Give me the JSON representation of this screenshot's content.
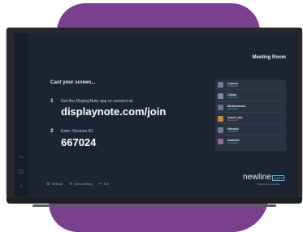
{
  "header": {
    "room_name": "Meeting Room"
  },
  "main": {
    "title": "Cast your screen...",
    "steps": [
      {
        "number": "1",
        "text": "Get the DisplayNote app or connect at:",
        "highlight": "displaynote.com/join"
      },
      {
        "number": "2",
        "text": "Enter Session ID:",
        "highlight": "667024"
      }
    ]
  },
  "sidebar": {
    "items": [
      {
        "icon": "display-icon",
        "glyph": "▭",
        "label": ""
      },
      {
        "icon": "whiteboard-icon",
        "glyph": "▢",
        "label": ""
      },
      {
        "icon": "home-icon",
        "glyph": "⌂",
        "label": ""
      }
    ]
  },
  "users": [
    {
      "name": "Lauren",
      "status": "Connected",
      "action": "i",
      "color": "#6d7fa0"
    },
    {
      "name": "Chloe",
      "status": "Connected",
      "action": "i",
      "color": "#7a8ba8"
    },
    {
      "name": "Mohammed",
      "status": "Connected",
      "action": "i",
      "color": "#5f728f"
    },
    {
      "name": "José Luis",
      "status": "Connected",
      "action": "i",
      "color": "#c98a2d"
    },
    {
      "name": "Hiroshi",
      "status": "Connected",
      "action": "i",
      "color": "#6e7b96"
    },
    {
      "name": "Isabelle",
      "status": "Connected",
      "action": "i",
      "color": "#8b6da0"
    }
  ],
  "controls": {
    "settings_label": "Settings",
    "new_meeting_label": "New meeting",
    "exit_label": "Exit"
  },
  "brand": {
    "name": "newline",
    "badge": "CAST",
    "powered_by": "Powered by DisplayNote"
  },
  "colors": {
    "screen_bg": "#1c2332",
    "panel_bg": "#2a3242",
    "accent_purple": "#7a3f8e",
    "status_green": "#3ecf8e",
    "brand_cyan": "#38c8e8"
  }
}
